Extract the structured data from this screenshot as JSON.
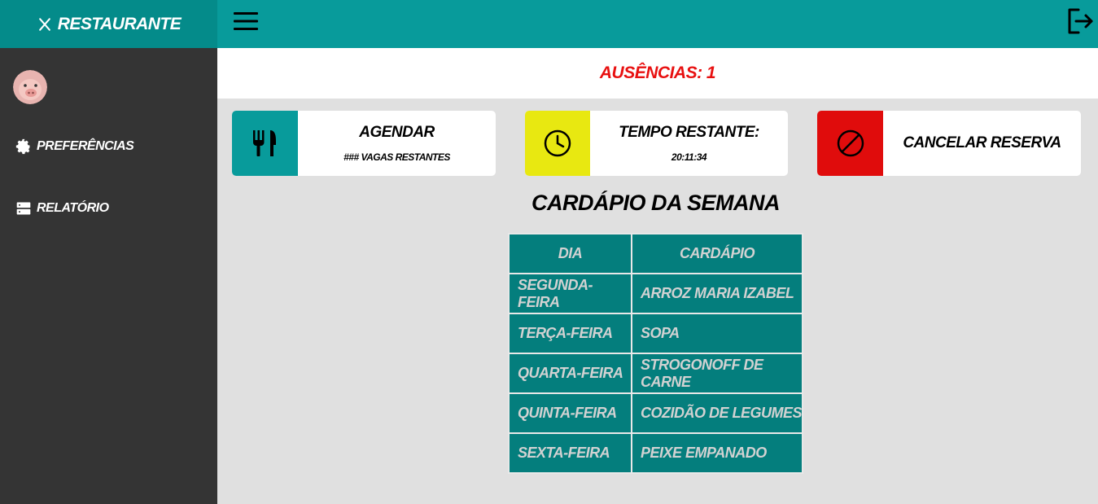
{
  "brand": {
    "title": "RESTAURANTE"
  },
  "sidebar": {
    "items": [
      {
        "label": "PREFERÊNCIAS",
        "icon": "gear-icon"
      },
      {
        "label": "RELATÓRIO",
        "icon": "server-icon"
      }
    ]
  },
  "absence": {
    "text": "AUSÊNCIAS: 1"
  },
  "cards": {
    "schedule": {
      "title": "AGENDAR",
      "sub": "### VAGAS RESTANTES",
      "color": "#089b9b"
    },
    "time": {
      "title": "TEMPO RESTANTE:",
      "sub": "20:11:34",
      "color": "#e8e811"
    },
    "cancel": {
      "title": "CANCELAR RESERVA",
      "color": "#e00c0c"
    }
  },
  "menu": {
    "title": "CARDÁPIO DA SEMANA",
    "headers": [
      "DIA",
      "CARDÁPIO"
    ],
    "rows": [
      [
        "SEGUNDA-FEIRA",
        "ARROZ MARIA IZABEL"
      ],
      [
        "TERÇA-FEIRA",
        "SOPA"
      ],
      [
        "QUARTA-FEIRA",
        "STROGONOFF DE CARNE"
      ],
      [
        "QUINTA-FEIRA",
        "COZIDÃO DE LEGUMES"
      ],
      [
        "SEXTA-FEIRA",
        "PEIXE EMPANADO"
      ]
    ]
  }
}
